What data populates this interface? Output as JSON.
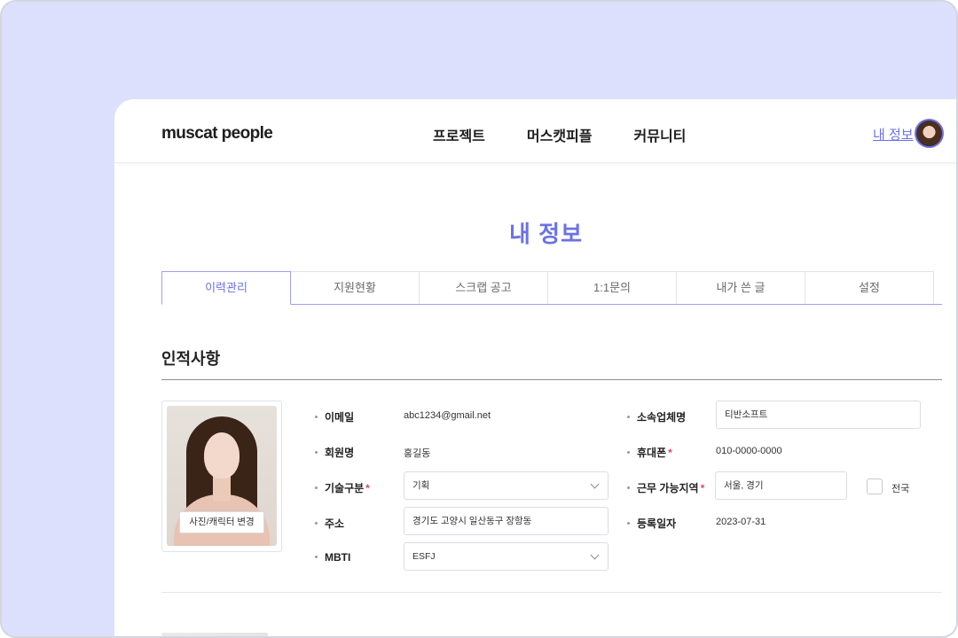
{
  "header": {
    "logo": "muscat people",
    "nav": [
      "프로젝트",
      "머스캣피플",
      "커뮤니티"
    ],
    "mypage_link": "내 정보"
  },
  "page": {
    "title": "내 정보",
    "tabs": [
      "이력관리",
      "지원현황",
      "스크랩 공고",
      "1:1문의",
      "내가 쓴 글",
      "설정"
    ],
    "active_tab": "이력관리",
    "section_title": "인적사항"
  },
  "profile": {
    "photo_button": "사진/캐릭터 변경",
    "email_label": "이메일",
    "email": "abc1234@gmail.net",
    "name_label": "회원명",
    "name": "홍길동",
    "skill_label": "기술구분",
    "skill": "기획",
    "address_label": "주소",
    "address": "경기도 고양시 일산동구 장항동",
    "mbti_label": "MBTI",
    "mbti": "ESFJ",
    "company_label": "소속업체명",
    "company": "티반소프트",
    "phone_label": "휴대폰",
    "phone": "010-0000-0000",
    "region_label": "근무 가능지역",
    "region": "서울, 경기",
    "nationwide_label": "전국",
    "registered_label": "등록일자",
    "registered": "2023-07-31",
    "required_mark": "*"
  },
  "colors": {
    "accent": "#6b72e6",
    "background": "#dde0fd",
    "required": "#e0455b"
  }
}
